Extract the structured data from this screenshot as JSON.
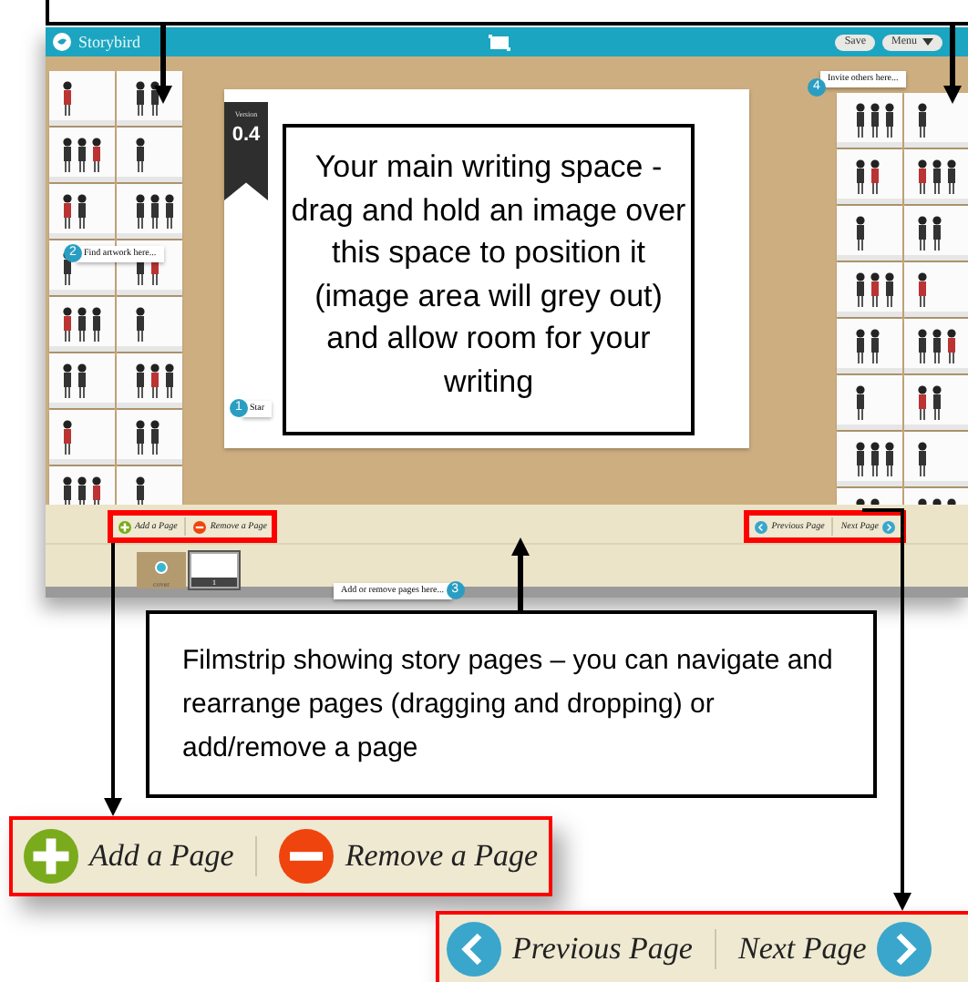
{
  "app_bar": {
    "logo": "Storybird",
    "buttons": [
      {
        "label": "Save",
        "kind": "plain"
      },
      {
        "label": "Menu",
        "kind": "dropdown"
      }
    ]
  },
  "left_gallery": {
    "hint_number": "2",
    "hint": "Find artwork here..."
  },
  "right_gallery": {
    "hint_number": "4",
    "hint": "Invite others here..."
  },
  "page": {
    "version_label": "Version",
    "version": "0.4",
    "hint_number": "1",
    "hint": "Star"
  },
  "filmstrip": {
    "actions": [
      {
        "label": "Add a Page",
        "kind": "add"
      },
      {
        "label": "Remove a Page",
        "kind": "remove"
      }
    ],
    "navigation": [
      {
        "label": "Previous Page",
        "kind": "previous"
      },
      {
        "label": "Next Page",
        "kind": "next"
      }
    ],
    "pages": [
      {
        "label": "cover",
        "kind": "cover",
        "selected": false
      },
      {
        "label": "1",
        "kind": "page",
        "selected": true
      }
    ],
    "hint_number": "3",
    "hint": "Add or remove pages here..."
  },
  "callouts": [
    {
      "kind": "writing",
      "text": "Your main writing space - drag and hold an image over this space to position it (image area will grey out) and allow room for your writing"
    },
    {
      "kind": "filmstrip",
      "text": "Filmstrip showing story pages – you can navigate and rearrange pages (dragging and dropping) or add/remove a page"
    }
  ],
  "zoomed_toolbars": [
    {
      "kind": "actions",
      "items": [
        {
          "label": "Add a Page",
          "kind": "add"
        },
        {
          "label": "Remove a Page",
          "kind": "remove"
        }
      ]
    },
    {
      "kind": "navigation",
      "items": [
        {
          "label": "Previous Page",
          "kind": "previous"
        },
        {
          "label": "Next Page",
          "kind": "next"
        }
      ]
    }
  ]
}
